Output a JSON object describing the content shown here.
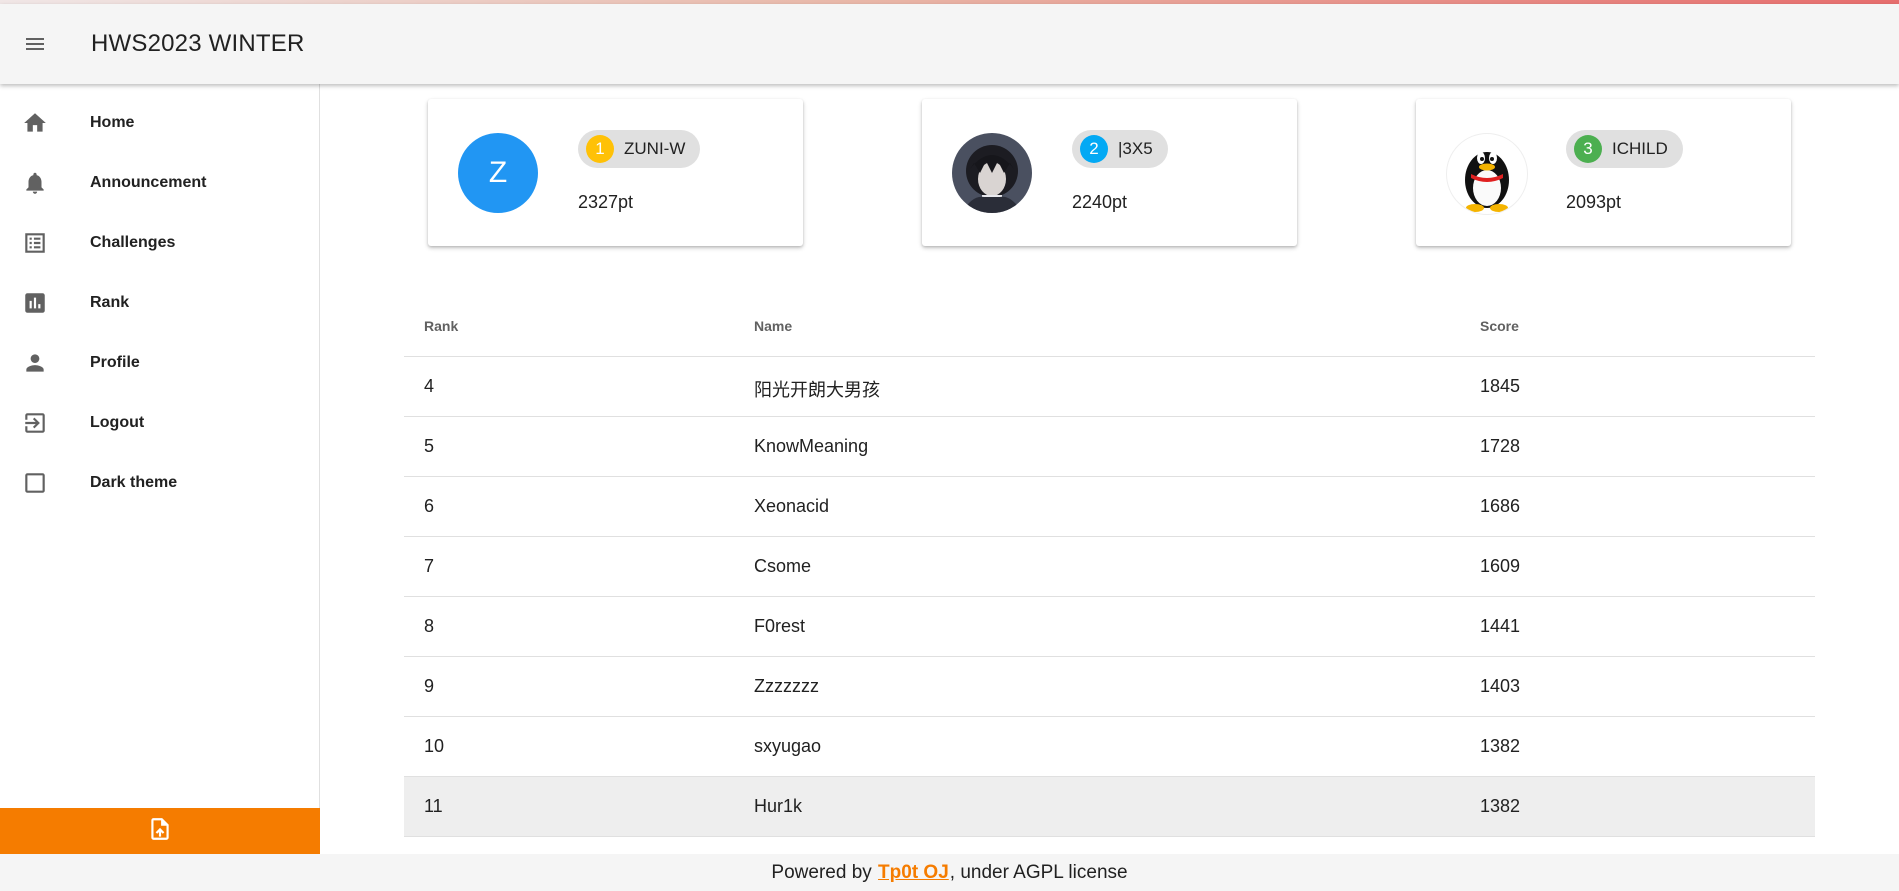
{
  "header": {
    "title": "HWS2023 WINTER",
    "menu_icon": "menu-icon"
  },
  "sidebar": {
    "items": [
      {
        "label": "Home",
        "icon": "home-icon"
      },
      {
        "label": "Announcement",
        "icon": "bell-icon"
      },
      {
        "label": "Challenges",
        "icon": "list-icon"
      },
      {
        "label": "Rank",
        "icon": "bar-chart-icon"
      },
      {
        "label": "Profile",
        "icon": "person-icon"
      },
      {
        "label": "Logout",
        "icon": "logout-icon"
      },
      {
        "label": "Dark theme",
        "icon": "checkbox-icon"
      }
    ],
    "upload_icon": "upload-file-icon",
    "accent_color": "#f57c00"
  },
  "podium": [
    {
      "rank": "1",
      "name": "ZUNI-W",
      "score": "2327pt",
      "avatar_letter": "Z",
      "badge_color": "#ffc107"
    },
    {
      "rank": "2",
      "name": "|3X5",
      "score": "2240pt",
      "avatar_letter": "",
      "badge_color": "#03a9f4"
    },
    {
      "rank": "3",
      "name": "ICHILD",
      "score": "2093pt",
      "avatar_letter": "",
      "badge_color": "#4caf50"
    }
  ],
  "table": {
    "headers": {
      "rank": "Rank",
      "name": "Name",
      "score": "Score"
    },
    "rows": [
      {
        "rank": "4",
        "name": "阳光开朗大男孩",
        "score": "1845"
      },
      {
        "rank": "5",
        "name": "KnowMeaning",
        "score": "1728"
      },
      {
        "rank": "6",
        "name": "Xeonacid",
        "score": "1686"
      },
      {
        "rank": "7",
        "name": "Csome",
        "score": "1609"
      },
      {
        "rank": "8",
        "name": "F0rest",
        "score": "1441"
      },
      {
        "rank": "9",
        "name": "Zzzzzzz",
        "score": "1403"
      },
      {
        "rank": "10",
        "name": "sxyugao",
        "score": "1382"
      },
      {
        "rank": "11",
        "name": "Hur1k",
        "score": "1382"
      }
    ]
  },
  "footer": {
    "prefix": "Powered by ",
    "link": "Tp0t OJ",
    "suffix": ", under AGPL license"
  }
}
